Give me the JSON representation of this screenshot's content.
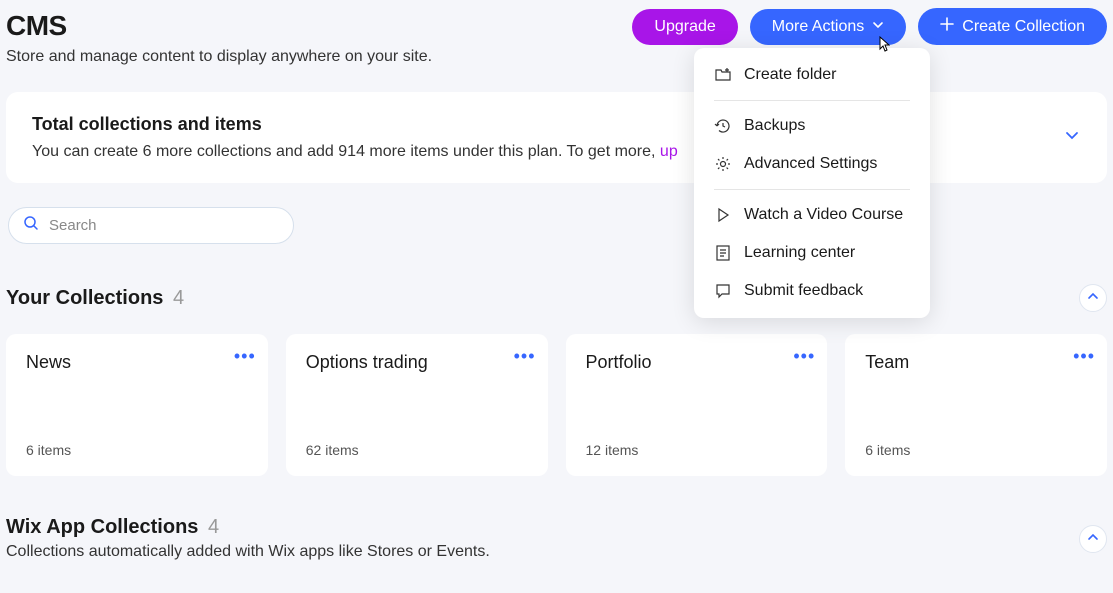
{
  "header": {
    "title": "CMS",
    "subtitle": "Store and manage content to display anywhere on your site.",
    "upgrade_label": "Upgrade",
    "more_actions_label": "More Actions",
    "create_collection_label": "Create Collection"
  },
  "info": {
    "title": "Total collections and items",
    "text_prefix": "You can create 6 more collections and add 914 more items under this plan. To get more, ",
    "link_text": "up"
  },
  "search": {
    "placeholder": "Search"
  },
  "dropdown": {
    "items": [
      {
        "label": "Create folder"
      },
      {
        "label": "Backups"
      },
      {
        "label": "Advanced Settings"
      },
      {
        "label": "Watch a Video Course"
      },
      {
        "label": "Learning center"
      },
      {
        "label": "Submit feedback"
      }
    ]
  },
  "your_collections": {
    "title": "Your Collections",
    "count": "4",
    "cards": [
      {
        "title": "News",
        "items": "6 items"
      },
      {
        "title": "Options trading",
        "items": "62 items"
      },
      {
        "title": "Portfolio",
        "items": "12 items"
      },
      {
        "title": "Team",
        "items": "6 items"
      }
    ]
  },
  "wix_collections": {
    "title": "Wix App Collections",
    "count": "4",
    "subtitle": "Collections automatically added with Wix apps like Stores or Events."
  }
}
